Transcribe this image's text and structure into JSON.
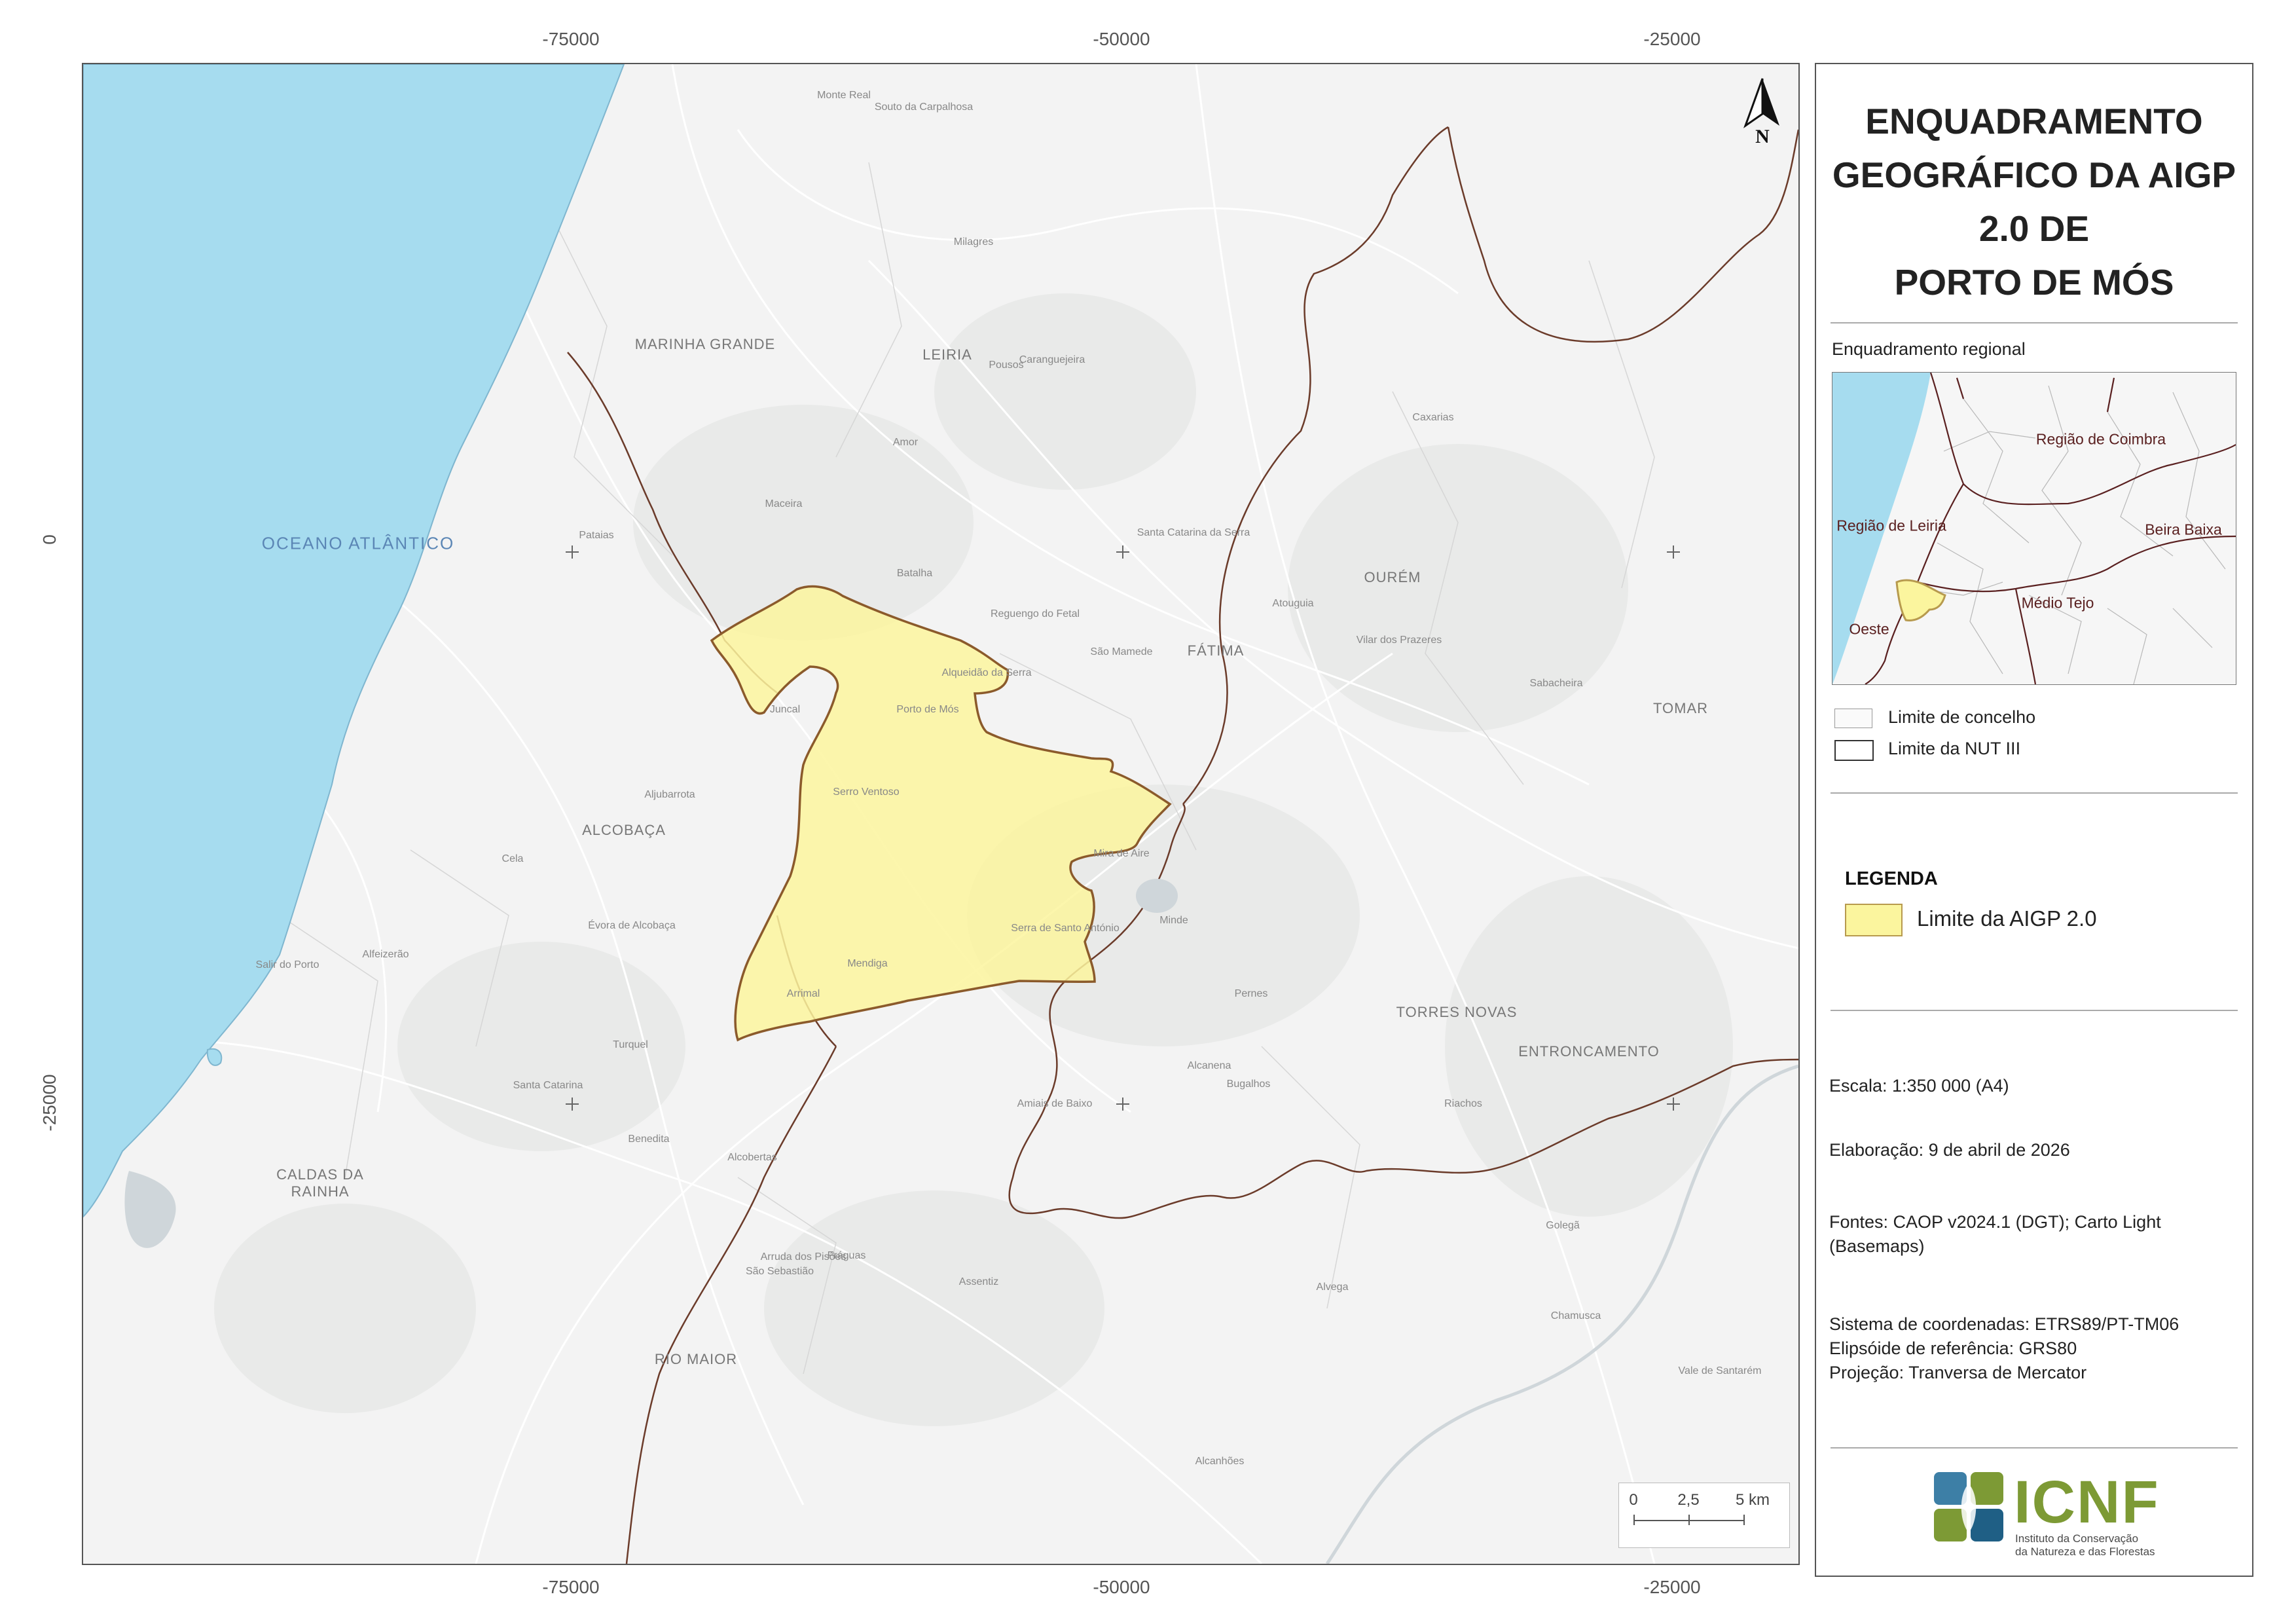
{
  "map": {
    "ocean_label": "OCEANO ATLÂNTICO",
    "x_ticks": [
      "-75000",
      "-50000",
      "-25000"
    ],
    "y_ticks": [
      "0",
      "-25000"
    ],
    "north_letter": "N",
    "scale": {
      "zero": "0",
      "mid": "2,5",
      "end": "5 km"
    },
    "major_places": [
      {
        "name": "MARINHA GRANDE",
        "id": "marinha-grande"
      },
      {
        "name": "LEIRIA",
        "id": "leiria"
      },
      {
        "name": "OURÉM",
        "id": "ourem"
      },
      {
        "name": "FÁTIMA",
        "id": "fatima"
      },
      {
        "name": "TOMAR",
        "id": "tomar"
      },
      {
        "name": "ALCOBAÇA",
        "id": "alcobaca"
      },
      {
        "name": "TORRES NOVAS",
        "id": "torres-novas"
      },
      {
        "name": "ENTRONCAMENTO",
        "id": "entroncamento"
      },
      {
        "name": "CALDAS DA",
        "id": "caldas-da"
      },
      {
        "name": "RAINHA",
        "id": "rainha"
      },
      {
        "name": "RIO MAIOR",
        "id": "rio-maior"
      }
    ],
    "minor_places": [
      "Monte Real",
      "Souto da Carpalhosa",
      "Milagres",
      "Caranguejeira",
      "Pousos",
      "Batalha",
      "Porto de Mós",
      "Juncal",
      "Mira de Aire",
      "Alcanena",
      "Minde",
      "Santa Catarina da Serra",
      "Caxarias",
      "Atouguia",
      "Vilar dos Prazeres",
      "Sabacheira",
      "Aljubarrota",
      "Benedita",
      "Turquel",
      "Santa Catarina",
      "Évora de Alcobaça",
      "Alfeizerão",
      "Salir do Porto",
      "Cela",
      "Pataias",
      "Maceira",
      "Amor",
      "Reguengo do Fetal",
      "Serra de Santo António",
      "Mendiga",
      "Arrimal",
      "Alcobertas",
      "Amiais de Baixo",
      "Pernes",
      "Riachos",
      "Chamusca",
      "Golegã",
      "Alcanhões",
      "Arruda dos Pisões",
      "São Sebastião",
      "Assentiz",
      "Fráguas",
      "Alqueidão da Serra",
      "São Mamede",
      "Serro Ventoso",
      "Bugalhos",
      "Alvega",
      "Vale de Santarém"
    ]
  },
  "panel": {
    "title": [
      "ENQUADRAMENTO",
      "GEOGRÁFICO DA AIGP",
      "2.0 DE",
      "PORTO DE MÓS"
    ],
    "regional_label": "Enquadramento regional",
    "inset_labels": {
      "coimbra": "Região de Coimbra",
      "leiria": "Região de Leiria",
      "beira_baixa": "Beira Baixa",
      "medio_tejo": "Médio Tejo",
      "oeste": "Oeste"
    },
    "boundary_keys": {
      "concelho": "Limite de concelho",
      "nut": "Limite da NUT III"
    },
    "legend_title": "LEGENDA",
    "legend_item": "Limite da AIGP 2.0",
    "scale_text": "Escala: 1:350 000 (A4)",
    "elaboration": "Elaboração: 9 de abril de 2026",
    "sources": [
      "Fontes: CAOP v2024.1 (DGT); Carto Light",
      "(Basemaps)"
    ],
    "crs": [
      "Sistema de coordenadas: ETRS89/PT-TM06",
      "Elipsóide de referência: GRS80",
      "Projeção: Tranversa de Mercator"
    ],
    "logo": {
      "name": "ICNF",
      "sub1": "Instituto da Conservação",
      "sub2": "da Natureza e das Florestas"
    }
  },
  "colors": {
    "ocean": "#a6dcef",
    "aigp_fill": "#fbf59e",
    "aigp_stroke": "#8b5a2b",
    "nut_border": "#6b3b2a",
    "logo_green": "#7d9a35",
    "logo_blue": "#3d7fa6"
  }
}
